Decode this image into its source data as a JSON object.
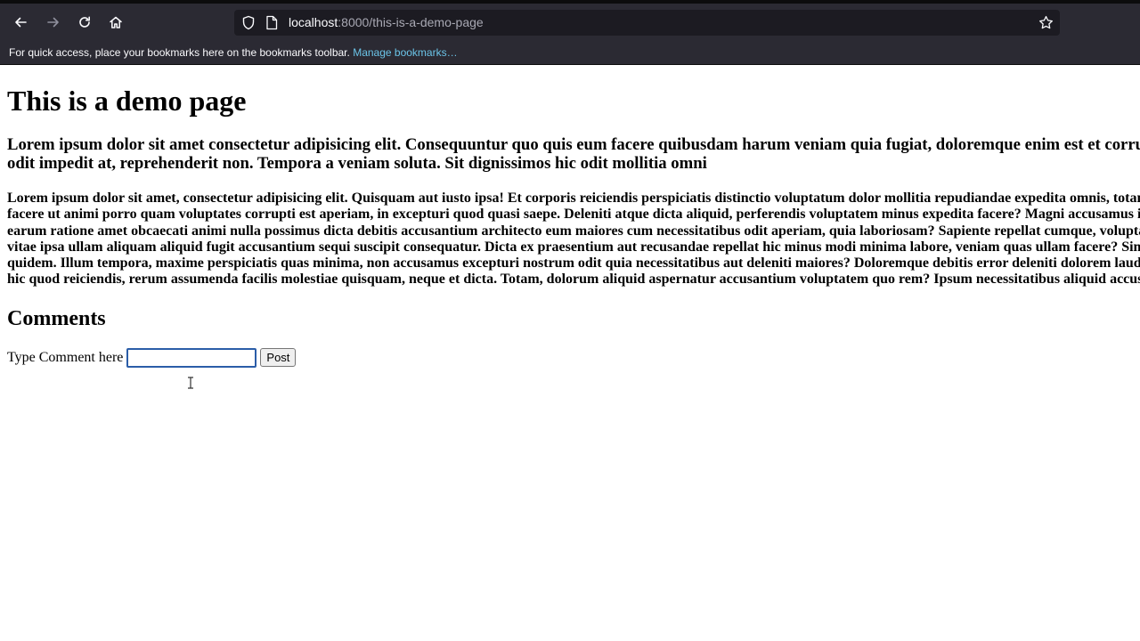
{
  "browser": {
    "url_host": "localhost",
    "url_path": ":8000/this-is-a-demo-page",
    "bookmarks_message": "For quick access, place your bookmarks here on the bookmarks toolbar.",
    "bookmarks_link": "Manage bookmarks…",
    "icons": [
      "back-icon",
      "forward-icon",
      "reload-icon",
      "home-icon",
      "shield-icon",
      "page-icon",
      "star-icon"
    ]
  },
  "page": {
    "title": "This is a demo page",
    "lead": "Lorem ipsum dolor sit amet consectetur adipisicing elit. Consequuntur quo quis eum facere quibusdam harum veniam quia fugiat, doloremque enim est et corrupti obcaecati odit impedit at, reprehenderit non. Tempora a veniam soluta. Sit dignissimos hic odit mollitia omni",
    "body": "Lorem ipsum dolor sit amet, consectetur adipisicing elit. Quisquam aut iusto ipsa! Et corporis reiciendis perspiciatis distinctio voluptatum dolor mollitia repudiandae expedita omnis, totam veniam optio facere ut animi porro quam voluptates corrupti est aperiam, in excepturi quod quasi saepe. Deleniti atque dicta aliquid, perferendis voluptatem minus expedita facere? Magni accusamus illo iste minus rem, earum ratione amet obcaecati animi nulla possimus dicta debitis accusantium architecto eum maiores cum necessitatibus odit aperiam, quia laboriosam? Sapiente repellat cumque, voluptates labore rem vitae ipsa ullam aliquam aliquid fugit accusantium sequi suscipit consequatur. Dicta ex praesentium aut recusandae repellat hic minus modi minima labore, veniam quas ullam facere? Sint nulla dolore quidem. Illum tempora, maxime perspiciatis quas minima, non accusamus excepturi nostrum odit quia necessitatibus aut deleniti maiores? Doloremque debitis error deleniti dolorem laudantium, officiis hic quod reiciendis, rerum assumenda facilis molestiae quisquam, neque et dicta. Totam, dolorum aliquid aspernatur accusantium voluptatem quo rem? Ipsum necessitatibus aliquid accusamus",
    "comments_heading": "Comments",
    "comment_label": "Type Comment here",
    "comment_value": "",
    "post_button": "Post"
  },
  "colors": {
    "chrome_bg": "#2b2a33",
    "urlbar_bg": "#1c1b22",
    "link": "#6bc4e8",
    "input_focus": "#2b5da8"
  }
}
